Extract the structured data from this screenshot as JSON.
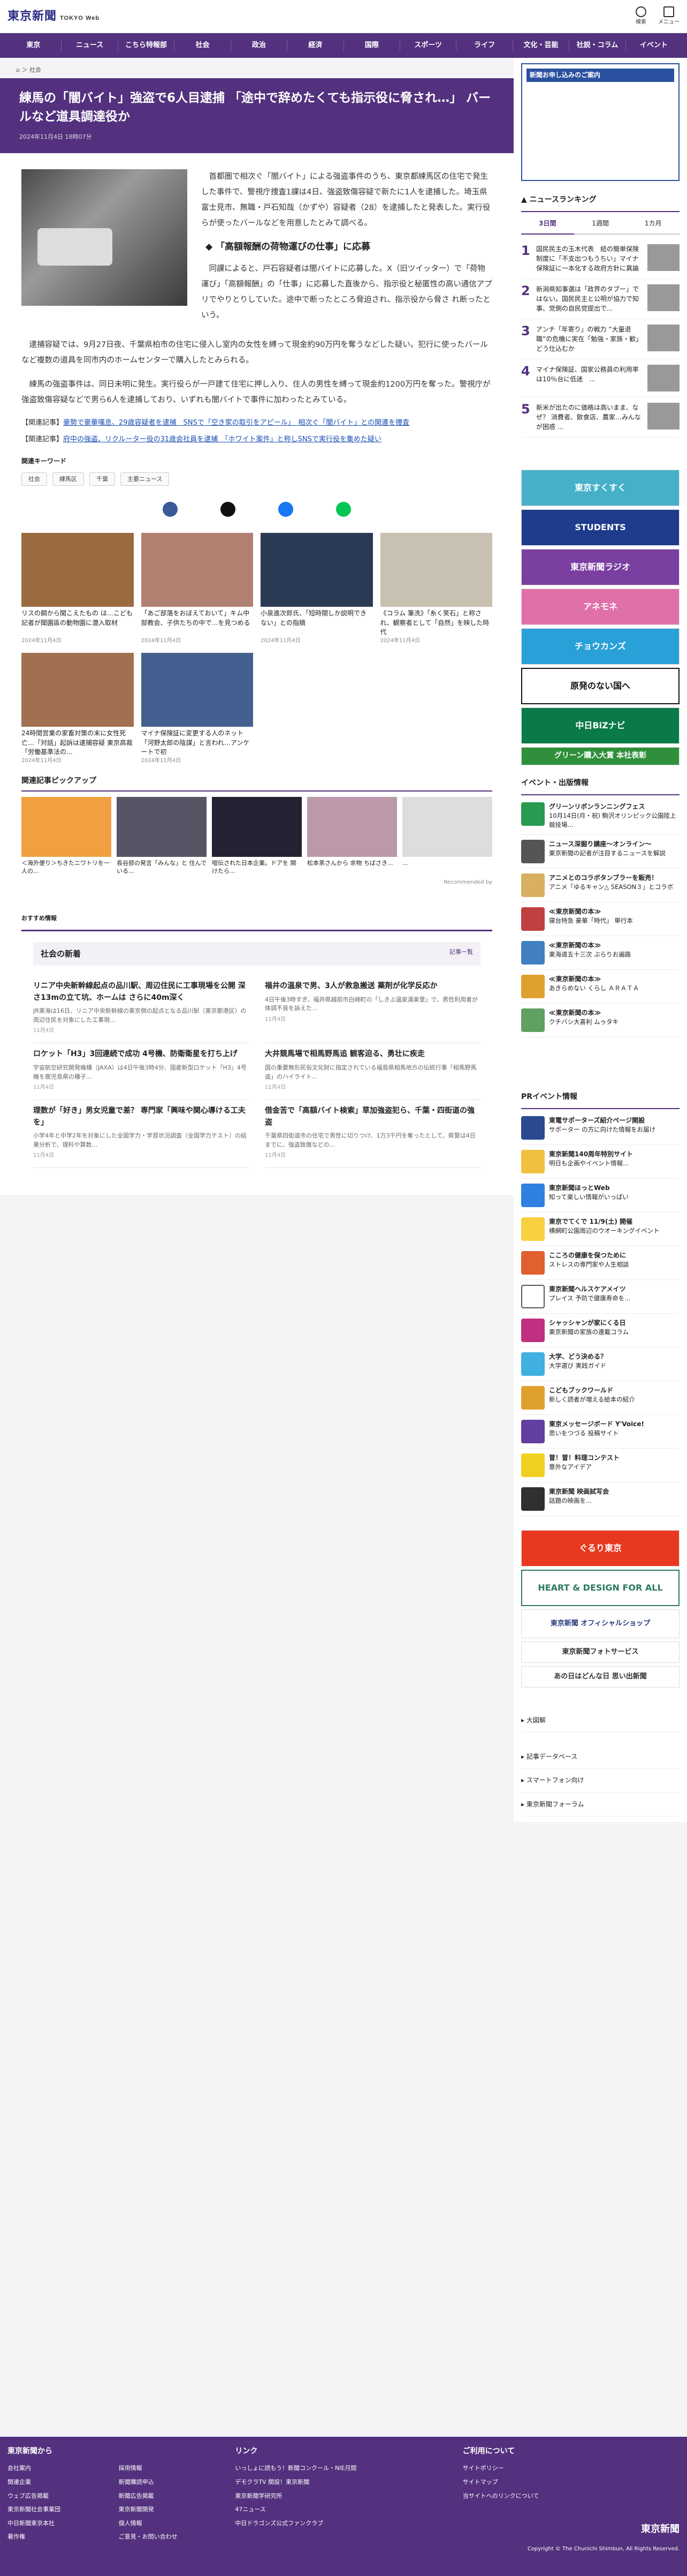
{
  "header": {
    "logo": "東京新聞",
    "logo_sub": "TOKYO Web",
    "search": "検索",
    "menu": "メニュー"
  },
  "nav": [
    "東京",
    "ニュース",
    "こちら特報部",
    "社会",
    "政治",
    "経済",
    "国際",
    "スポーツ",
    "ライフ",
    "文化・芸能",
    "社説・コラム",
    "イベント"
  ],
  "breadcrumb": [
    "社会"
  ],
  "article": {
    "title": "練馬の「闇バイト」強盗で6人目逮捕 「途中で辞めたくても指示役に脅され…」 バールなど道具調達役か",
    "date": "2024年11月4日 18時07分",
    "p1": "首都圏で相次ぐ「闇バイト」による強盗事件のうち、東京都練馬区の住宅で発生した事件で、警視庁捜査1課は4日、強盗致傷容疑で新たに1人を逮捕した。埼玉県富士見市、無職・戸石知哉（かずや）容疑者（28）を逮捕したと発表した。実行役らが使ったバールなどを用意したとみて調べる。",
    "h2": "「高額報酬の荷物運びの仕事」に応募",
    "p2": "同課によると、戸石容疑者は闇バイトに応募した。X（旧ツイッター）で「荷物運び」「高額報酬」の「仕事」に応募した直後から、指示役と秘匿性の高い通信アプリでやりとりしていた。途中で断ったところ脅迫され、指示役から脅さ れ断ったという。",
    "p3": "逮捕容疑では、9月27日夜、千葉県柏市の住宅に侵入し室内の女性を縛って現金約90万円を奪うなどした疑い。犯行に使ったバールなど複数の道具を同市内のホームセンターで購入したとみられる。",
    "p4": "練馬の強盗事件は、同日未明に発生。実行役らが一戸建て住宅に押し入り、住人の男性を縛って現金約1200万円を奪った。警視庁が強盗致傷容疑などで男ら6人を逮捕しており、いずれも闇バイトで事件に加わったとみている。",
    "related": [
      {
        "tag": "【関連記事】",
        "text": "豪勢で豪華嘆息、29歳容疑者を逮捕　SNSで「空き家の取引をアピール」　相次ぐ「闇バイト」との関連を捜査"
      },
      {
        "tag": "【関連記事】",
        "text": "府中の強盗、リクルーター役の31歳会社員を逮捕　「ホワイト案件」と称しSNSで実行役を集めた疑い"
      }
    ]
  },
  "keywords": {
    "label": "関連キーワード",
    "items": [
      "社会",
      "練馬区",
      "千葉",
      "主要ニュース"
    ]
  },
  "grid_cards": [
    {
      "t": "リスの餌から聞こえたもの は…こども記者が聞園區の動物園に潜入取材",
      "d": "2024年11月4日"
    },
    {
      "t": "「あご部落をおぼえておいて」キム中部教会、子供たちの中で…を見つめる",
      "d": "2024年11月4日"
    },
    {
      "t": "小泉進次郎氏、「短時間しか説明できない」との指摘",
      "d": "2024年11月4日"
    },
    {
      "t": "《コラム 筆洗》「糸く笑石」と称され、観察者として「自然」を映した時代",
      "d": "2024年11月4日"
    },
    {
      "t": "24時間営業の家畜対策の末に女性死亡…「対話」起訴は逮捕容疑 東京高裁「労働基準法の...",
      "d": "2024年11月4日"
    },
    {
      "t": "マイナ保険証に変更する人のネット「河野太郎の陰謀」と言われ…アンケートで初 ",
      "d": "2024年11月4日"
    }
  ],
  "pickup": {
    "label": "関連記事ピックアップ",
    "items": [
      "＜海外便り＞ちきたニワトリを一人の...",
      "長谷部の発言「みんな」と 住んでいる... ",
      "喧伝された日本企業。ドアを 開けたら...",
      "松本茶さんから 余物 ちばさき...",
      "..."
    ],
    "rec": "Recommended by"
  },
  "osusume": "おすすめ情報",
  "social": {
    "title": "社会の新着",
    "more": "記事一覧",
    "items": [
      {
        "t": "リニア中央新幹線起点の品川駅、周辺住民に工事現場を公開 深さ13mの立て坑、ホームは さらに40m深く",
        "s": "JR東海は16日、リニア中央新幹線の東京側の起点となる品川駅（東京都港区）の周辺住民を対象にした工事現...",
        "d": "11月4日"
      },
      {
        "t": "福井の温泉で男、3人が救急搬送 薬剤が化学反応か",
        "s": "4日午後3時すぎ、福井県越前市白崎町の「しきぶ温泉湯楽里」で、男性利用者が体調不良を訴えた...",
        "d": "11月4日"
      },
      {
        "t": "ロケット「H3」3回連続で成功 4号機、防衛衛星を打ち上げ",
        "s": "宇宙航空研究開発機構（JAXA）は4日午後3時4分、国産新型ロケット「H3」4号機を鹿児島県の種子...",
        "d": "11月4日"
      },
      {
        "t": "大井競馬場で相馬野馬追 観客迫る、勇壮に疾走",
        "s": "国の重要無形民俗文化財に指定されている福島県相馬地方の伝統行事「相馬野馬追」のハイライト...",
        "d": "11月4日"
      },
      {
        "t": "理数が「好き」男女児童で差？ 専門家「興味や関心導ける工夫を」",
        "s": "小学4年と中学2年を対象にした全国学力・学習状況調査（全国学力テスト）の結果分析で、理科や算数...",
        "d": "11月4日"
      },
      {
        "t": "借金苦で「高額バイト検索」草加強盗犯ら、千葉・四街道の強盗",
        "s": "千葉県四街道市の住宅で男性に切りつけ、1万3千円を奪ったとして、県警は4日までに、強盗致傷などの...",
        "d": "11月4日"
      }
    ]
  },
  "side": {
    "promo": "新聞お申し込みのご案内",
    "ranking": {
      "title": "ニュースランキング",
      "tabs": [
        "3日間",
        "1週間",
        "1カ月"
      ],
      "items": [
        {
          "n": "1",
          "t": "国民民主の玉木代表　結の簡単保険制度に「不支出つもうちい」マイナ保険証に一本化する政府方針に異論"
        },
        {
          "n": "2",
          "t": "新潟県知事選は「政界のタブー」ではない。国民民主と公明が協力で知事、党側の自民党提出で..."
        },
        {
          "n": "3",
          "t": "アンチ「年寄り」の戦力 “大量退職”の危機に実在「勉強・家族・歓」どう仕込むか"
        },
        {
          "n": "4",
          "t": "マイナ保険証、国家公務員の利用率は10％台に低迷　..."
        },
        {
          "n": "5",
          "t": "新米が出たのに価格は高いまま、なぜ？ 消費者、飲食店、農家…みんなが困惑 ..."
        }
      ]
    },
    "banners": [
      "東京すくすく",
      "STUDENTS",
      "東京新聞ラジオ",
      "アネモネ",
      "チョウカンズ",
      "原発のない国へ",
      "中日BiZナビ",
      "グリーン購入大賞 本社表彰"
    ],
    "events_h": "イベント・出版情報",
    "events": [
      {
        "b": "グリーンリボンランニングフェス",
        "t": "10月14日(月・祝) 駒沢オリンピック公園陸上競技場..."
      },
      {
        "b": "ニュース深掘り講座〜オンライン〜",
        "t": "東京新聞の記者が注目するニュースを解説"
      },
      {
        "b": "アニメとのコラボタンブラーを販売！",
        "t": "アニメ「ゆるキャン△ SEASON３」とコラボ"
      },
      {
        "b": "≪東京新聞の本≫",
        "t": "寝台特急 豪華「時代」 単行本"
      },
      {
        "b": "≪東京新聞の本≫",
        "t": "東海道五十三次 ぶらりお遍路"
      },
      {
        "b": "≪東京新聞の本≫",
        "t": "あきらめない くらし ＡＲＡＴＡ"
      },
      {
        "b": "≪東京新聞の本≫",
        "t": "クチバシ大喜利 ムゥタキ"
      }
    ],
    "pr_h": "PRイベント情報",
    "pr": [
      {
        "b": "東電サポーターズ紹介ページ開設",
        "t": "サポーター の方に向けた情報をお届け"
      },
      {
        "b": "東京新聞140周年特別サイト",
        "t": "明日も企画やイベント情報..."
      },
      {
        "b": "東京新聞ほっとWeb",
        "t": "知って楽しい情報がいっぱい"
      },
      {
        "b": "東京でてくで 11/9(土) 開催",
        "t": "横網町公園周辺のウオーキングイベント"
      },
      {
        "b": "こころの健康を保つために",
        "t": "ストレスの専門家や人生相談"
      },
      {
        "b": "東京新聞ヘルスケアメイツ",
        "t": "プレイス 予防で健康寿命を..."
      },
      {
        "b": "シャッシャンが家にくる日",
        "t": "東京新聞の家族の連載コラム"
      },
      {
        "b": "大学、どう決める？",
        "t": "大学選び 実践ガイド"
      },
      {
        "b": "こどもブックワールド",
        "t": "新しく読者が増える絵本の紹介"
      },
      {
        "b": "東京メッセージボード Y'Voice!",
        "t": "思いをつづる 投稿サイト"
      },
      {
        "b": "冒！冒！料理コンテスト",
        "t": "意外なアイデア"
      },
      {
        "b": "東京新聞 映画試写会",
        "t": "話題の映画を..."
      }
    ],
    "bottom_banners": [
      "ぐるり東京",
      "HEART & DESIGN FOR ALL",
      "東京新聞 オフィシャルショップ",
      "東京新聞フォトサービス",
      "あの日はどんな日 思い出新聞"
    ],
    "links": [
      "大図解",
      "記事データベース",
      "スマートフォン向け",
      "東京新聞フォーラム"
    ]
  },
  "footer": {
    "col1_h": "東京新聞から",
    "col1": [
      "会社案内",
      "採用情報",
      "関連企業",
      "新聞購読申込",
      "ウェブ広告掲載",
      "新聞広告掲載",
      "東京新聞社会事業団",
      "東京新聞開発",
      "中日新聞東京本社",
      "個人情報",
      "著作権",
      "ご意見・お問い合わせ"
    ],
    "col2_h": "リンク",
    "col2": [
      "いっしょに読もう！新聞コンクール・NIE月間",
      "デモクラTV 開設！東京新聞",
      "東京新聞学研究所",
      "47ニュース",
      "中日ドラゴンズ公式ファンクラブ"
    ],
    "col3_h": "ご利用について",
    "col3": [
      "サイトポリシー",
      "サイトマップ",
      "当サイトへのリンクについて"
    ],
    "copyright": "Copyright © The Chunichi Shimbun, All Rights Reserved."
  },
  "colors": {
    "brand": "#53317e"
  }
}
